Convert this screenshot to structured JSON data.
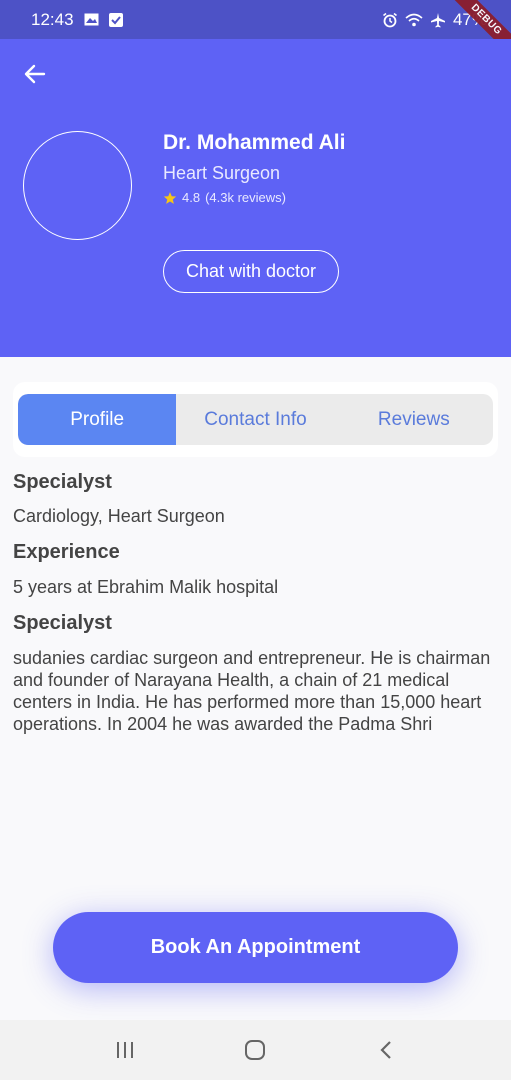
{
  "status_bar": {
    "time": "12:43",
    "battery": "47%",
    "debug_label": "DEBUG",
    "icons_left": [
      "image-icon",
      "check-square-icon"
    ],
    "icons_right": [
      "alarm-icon",
      "wifi-icon",
      "airplane-icon"
    ]
  },
  "doctor": {
    "name": "Dr. Mohammed Ali",
    "specialty": "Heart Surgeon",
    "rating": "4.8",
    "reviews": "(4.3k reviews)",
    "chat_label": "Chat with doctor"
  },
  "tabs": [
    {
      "label": "Profile",
      "active": true
    },
    {
      "label": "Contact Info",
      "active": false
    },
    {
      "label": "Reviews",
      "active": false
    }
  ],
  "profile": {
    "section1_title": "Specialyst",
    "section1_text": "Cardiology, Heart Surgeon",
    "section2_title": "Experience",
    "section2_text": "5 years at Ebrahim Malik hospital",
    "section3_title": "Specialyst",
    "section3_text": "sudanies cardiac surgeon and entrepreneur. He is chairman and founder of Narayana Health, a chain of 21 medical centers in India. He has performed more than 15,000 heart operations. In 2004 he was awarded the Padma Shri"
  },
  "book_label": "Book An Appointment",
  "colors": {
    "primary": "#5e62f5",
    "status_bar": "#4d52c6",
    "tab_active": "#5b86f2",
    "tab_inactive_text": "#5a7bdb",
    "star": "#f5c518"
  }
}
